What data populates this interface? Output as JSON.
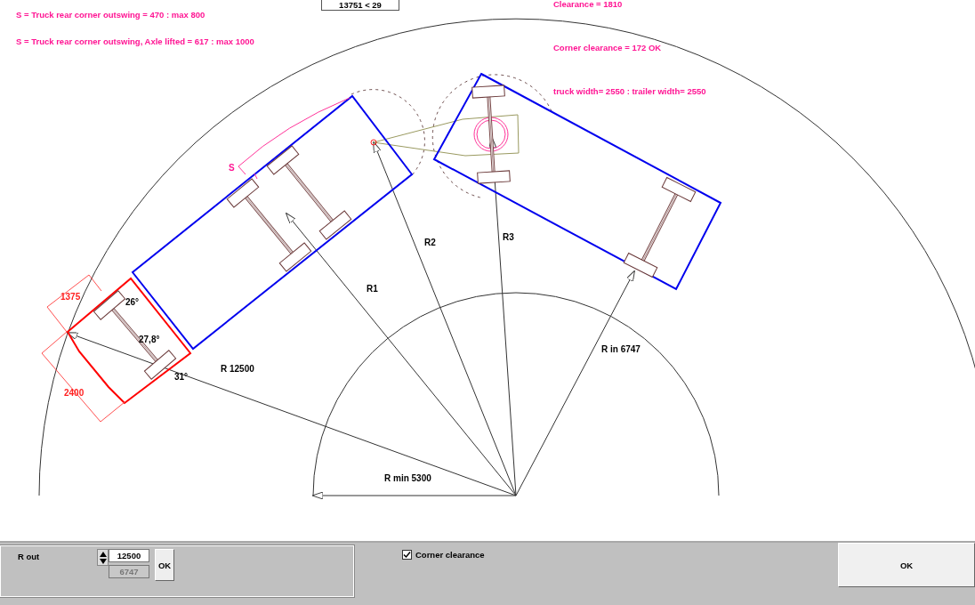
{
  "header_box": "13751 < 29",
  "messages": [
    {
      "text": "S = Truck rear corner outswing = 470 :   max 800"
    },
    {
      "text": "S = Truck rear corner outswing, Axle lifted = 617 :   max 1000"
    },
    {
      "text": "Clearance = 1810"
    },
    {
      "text": "Corner clearance = 172 OK"
    },
    {
      "text": "truck width= 2550 : trailer width= 2550"
    }
  ],
  "labels": [
    {
      "text": "1375",
      "kind": "dimension"
    },
    {
      "text": "2400",
      "kind": "dimension"
    },
    {
      "text": "26°",
      "kind": "label"
    },
    {
      "text": "27,8°",
      "kind": "label"
    },
    {
      "text": "31°",
      "kind": "label"
    },
    {
      "text": "S",
      "kind": "note"
    },
    {
      "text": "R 12500",
      "kind": "label"
    },
    {
      "text": "R1",
      "kind": "label"
    },
    {
      "text": "R2",
      "kind": "label"
    },
    {
      "text": "R3",
      "kind": "label"
    },
    {
      "text": "R in  6747",
      "kind": "label"
    },
    {
      "text": "R min  5300",
      "kind": "label"
    }
  ],
  "r_out": {
    "label": "R out",
    "value": "12500",
    "secondary_value": "6747",
    "secondary_disabled": true,
    "button": "OK"
  },
  "corner_clearance": {
    "label": "Corner clearance",
    "checked": true
  },
  "ok_button": "OK"
}
